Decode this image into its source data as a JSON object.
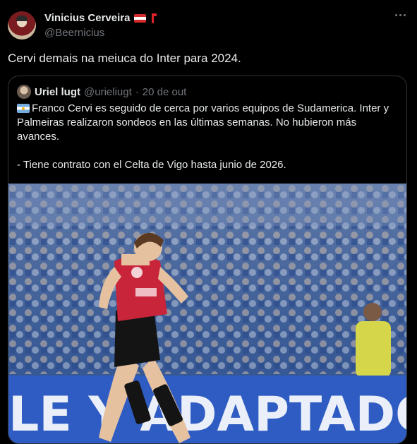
{
  "author": {
    "display_name": "Vinicius Cerveira",
    "handle": "@Beernicius"
  },
  "tweet": {
    "text": "Cervi demais na meiuca do Inter para 2024."
  },
  "quoted": {
    "display_name": "Uriel lugt",
    "handle": "@urieliugt",
    "separator": "·",
    "date": "20 de out",
    "line1": "Franco Cervi es seguido de cerca por varios equipos de Sudamerica. Inter y Palmeiras realizaron sondeos en las últimas semanas. No hubieron más avances.",
    "line2": "- Tiene contrato con el Celta de Vigo hasta junio de 2026."
  },
  "photo": {
    "banner_text": "LE Y ADAPTADO A"
  },
  "icons": {
    "flag_author": "austria-flag-icon",
    "flag_quote": "argentina-flag-icon",
    "more": "more-options-icon"
  },
  "colors": {
    "background": "#000000",
    "text": "#e7e9ea",
    "secondary_text": "#71767b",
    "border": "#2f3336"
  }
}
